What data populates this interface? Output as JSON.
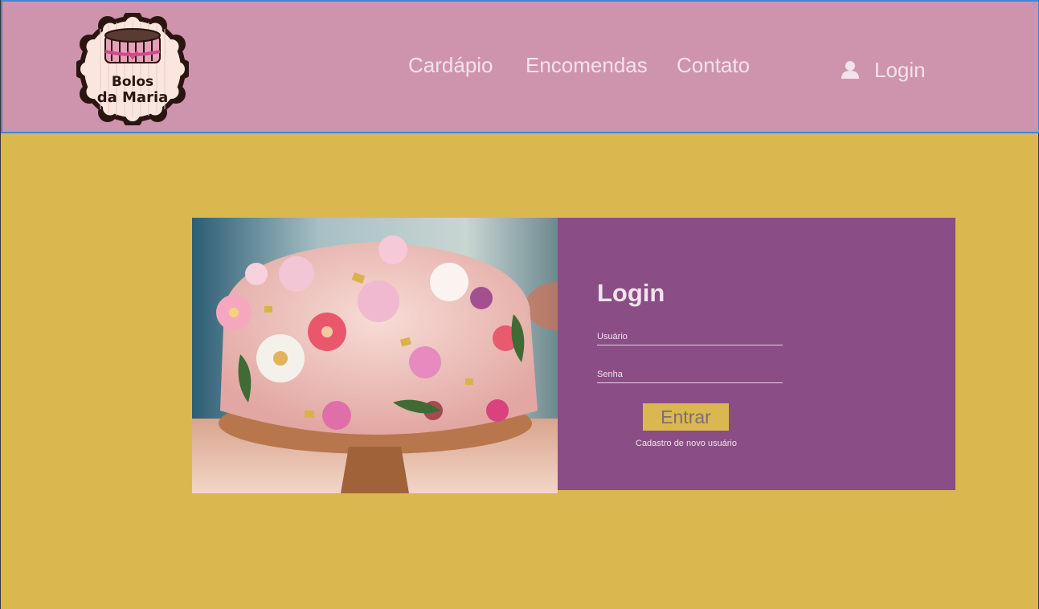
{
  "brand": {
    "name_line1": "Bolos",
    "name_line2": "da Maria"
  },
  "nav": {
    "items": [
      {
        "label": "Cardápio"
      },
      {
        "label": "Encomendas"
      },
      {
        "label": "Contato"
      }
    ],
    "login_label": "Login",
    "login_icon": "user-icon"
  },
  "login_form": {
    "title": "Login",
    "username_placeholder": "Usuário",
    "password_placeholder": "Senha",
    "submit_label": "Entrar",
    "signup_link": "Cadastro de novo usuário"
  },
  "colors": {
    "header_bg": "#cf94ad",
    "page_bg": "#dab84f",
    "panel_bg": "#8a4d86",
    "button_bg": "#dab84f"
  }
}
